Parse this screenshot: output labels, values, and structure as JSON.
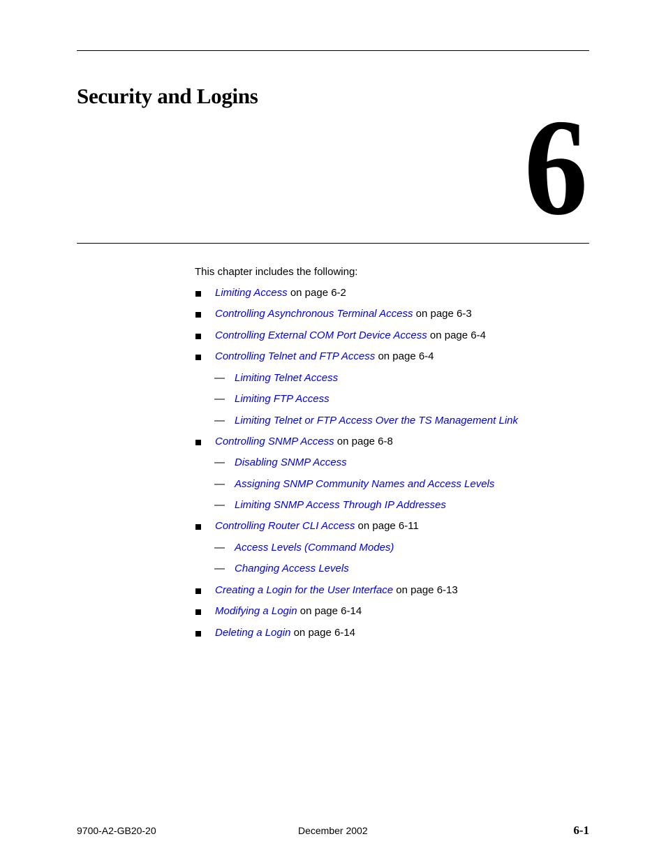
{
  "chapter": {
    "title": "Security and Logins",
    "number": "6"
  },
  "intro": "This chapter includes the following:",
  "toc": [
    {
      "level": 1,
      "link": "Limiting Access",
      "suffix": " on page 6-2"
    },
    {
      "level": 1,
      "link": "Controlling Asynchronous Terminal Access",
      "suffix": " on page 6-3"
    },
    {
      "level": 1,
      "link": "Controlling External COM Port Device Access",
      "suffix": " on page 6-4"
    },
    {
      "level": 1,
      "link": "Controlling Telnet and FTP Access",
      "suffix": " on page 6-4"
    },
    {
      "level": 2,
      "link": "Limiting Telnet Access",
      "suffix": ""
    },
    {
      "level": 2,
      "link": "Limiting FTP Access",
      "suffix": ""
    },
    {
      "level": 2,
      "link": "Limiting Telnet or FTP Access Over the TS Management Link",
      "suffix": ""
    },
    {
      "level": 1,
      "link": "Controlling SNMP Access",
      "suffix": " on page 6-8"
    },
    {
      "level": 2,
      "link": "Disabling SNMP Access",
      "suffix": ""
    },
    {
      "level": 2,
      "link": "Assigning SNMP Community Names and Access Levels",
      "suffix": ""
    },
    {
      "level": 2,
      "link": "Limiting SNMP Access Through IP Addresses",
      "suffix": ""
    },
    {
      "level": 1,
      "link": "Controlling Router CLI Access",
      "suffix": " on page 6-11"
    },
    {
      "level": 2,
      "link": "Access Levels (Command Modes)",
      "suffix": ""
    },
    {
      "level": 2,
      "link": "Changing Access Levels",
      "suffix": ""
    },
    {
      "level": 1,
      "link": "Creating a Login for the User Interface",
      "suffix": " on page 6-13"
    },
    {
      "level": 1,
      "link": "Modifying a Login",
      "suffix": " on page 6-14"
    },
    {
      "level": 1,
      "link": "Deleting a Login",
      "suffix": " on page 6-14"
    }
  ],
  "dash_glyph": "—",
  "footer": {
    "doc_number": "9700-A2-GB20-20",
    "date": "December 2002",
    "page": "6-1"
  },
  "colors": {
    "link": "#0000ee",
    "text": "#000000"
  }
}
